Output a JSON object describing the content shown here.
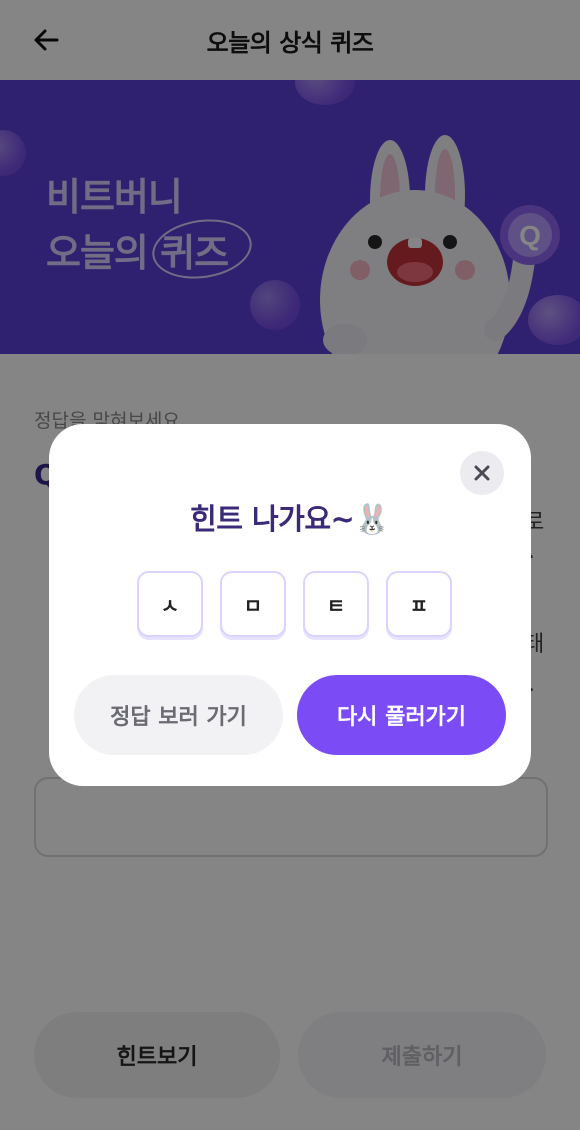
{
  "header": {
    "title": "오늘의 상식 퀴즈",
    "back_icon": "arrow-left-icon"
  },
  "banner": {
    "line1": "비트버니",
    "line2": "오늘의 퀴즈",
    "bg_color": "#5b3fd6",
    "mascot_badge": "Q"
  },
  "content": {
    "prompt": "정답을 맞혀보세요",
    "question_mark": "Q",
    "side_fragments": [
      "로",
      ".",
      "태",
      "."
    ],
    "answer_value": ""
  },
  "buttons": {
    "hint": "힌트보기",
    "submit": "제출하기"
  },
  "modal": {
    "title": "힌트 나가요~🐰",
    "hint_chars": [
      "ㅅ",
      "ㅁ",
      "ㅌ",
      "ㅍ"
    ],
    "answer_button": "정답 보러 가기",
    "retry_button": "다시 풀러가기",
    "close_icon": "close-icon",
    "accent_color": "#7b4cf5"
  }
}
